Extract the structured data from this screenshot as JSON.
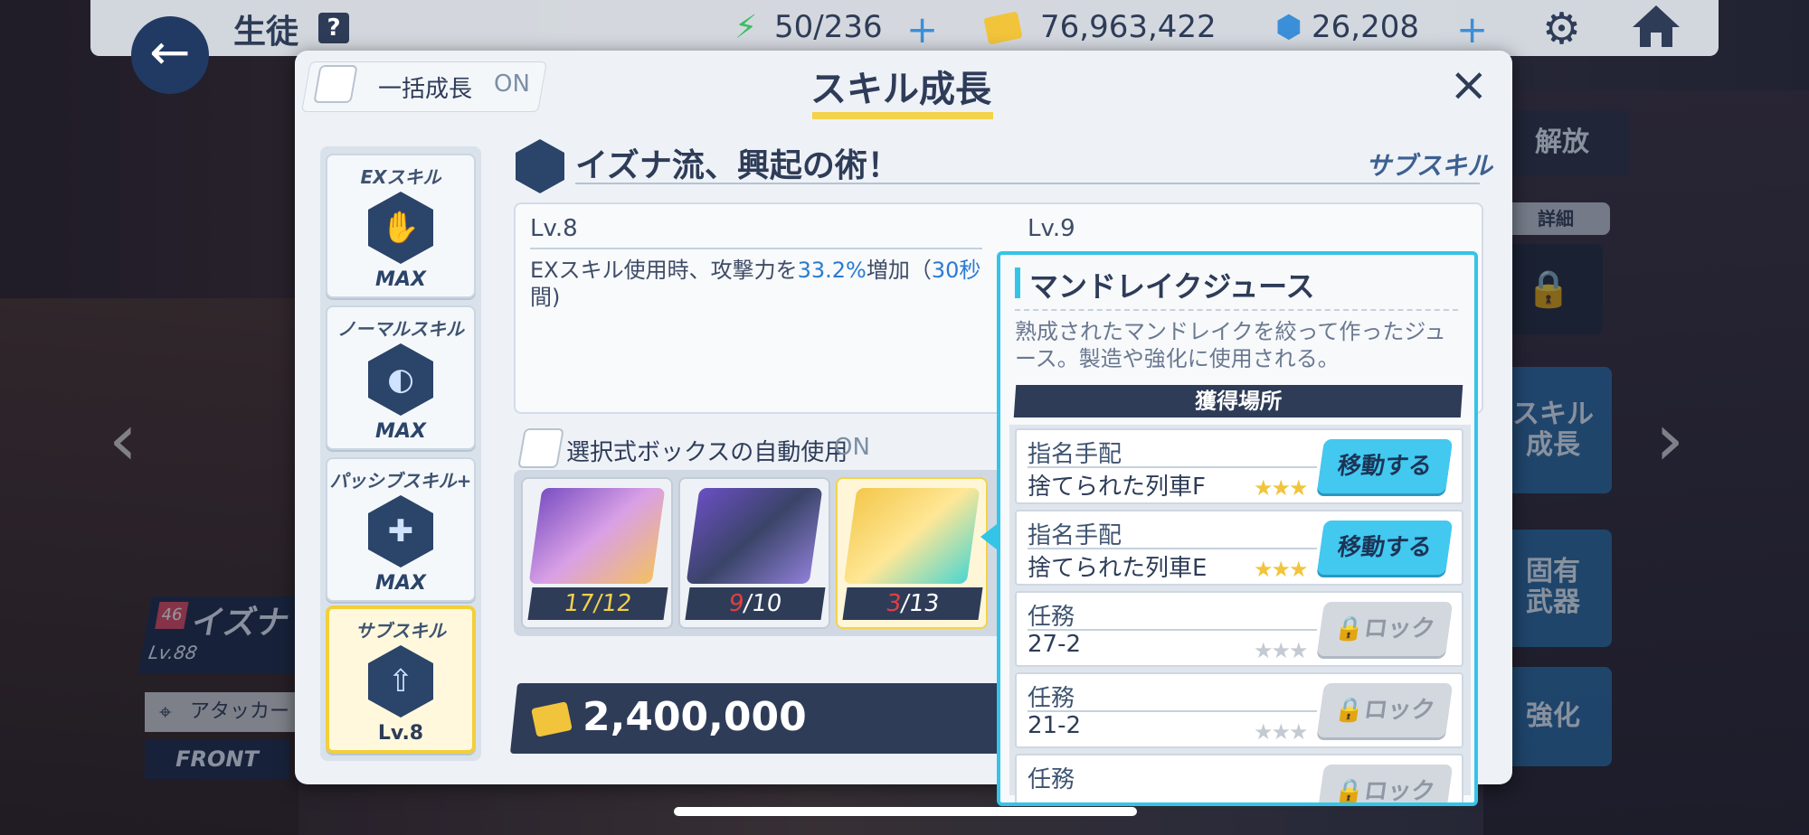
{
  "topbar": {
    "title": "生徒",
    "help": "?",
    "ap": "50/236",
    "credits": "76,963,422",
    "gems": "26,208",
    "plus": "+"
  },
  "right_panel": {
    "unlock": "解放",
    "detail": "詳細",
    "skill_growth": "スキル\n成長",
    "unique_weapon": "固有\n武器",
    "enhance": "強化"
  },
  "student": {
    "level_badge": "46",
    "name": "イズナ",
    "lv": "Lv.88",
    "role": "アタッカー",
    "position": "FRONT"
  },
  "modal": {
    "bulk_label": "一括成長",
    "bulk_on": "ON",
    "title": "スキル成長",
    "close": "×",
    "skills": [
      {
        "label": "EXスキル",
        "status": "MAX",
        "glyph": "✋"
      },
      {
        "label": "ノーマルスキル",
        "status": "MAX",
        "glyph": "◐"
      },
      {
        "label": "パッシブスキル+",
        "status": "MAX",
        "glyph": "✚"
      },
      {
        "label": "サブスキル",
        "status": "Lv.8",
        "glyph": "⇧"
      }
    ],
    "skill_name": "イズナ流、興起の術！",
    "skill_type": "サブスキル",
    "lv_current": "Lv.8",
    "lv_next": "Lv.9",
    "desc_pre": "EXスキル使用時、攻撃力を",
    "desc_val": "33.2%",
    "desc_mid": "増加（",
    "desc_time": "30秒",
    "desc_post": "間)",
    "auto_label": "選択式ボックスの自動使用",
    "auto_on": "ON",
    "items": [
      {
        "have": "17",
        "need": "/12"
      },
      {
        "have": "9",
        "need": "/10"
      },
      {
        "have": "3",
        "need": "/13"
      }
    ],
    "cost": "2,400,000"
  },
  "popup": {
    "title": "マンドレイクジュース",
    "desc": "熟成されたマンドレイクを絞って作ったジュース。製造や強化に使用される。",
    "header": "獲得場所",
    "sources": [
      {
        "cat": "指名手配",
        "name": "捨てられた列車F",
        "stars": "★★★",
        "btn": "移動する"
      },
      {
        "cat": "指名手配",
        "name": "捨てられた列車E",
        "stars": "★★★",
        "btn": "移動する"
      },
      {
        "cat": "任務",
        "name": "27-2",
        "stars": "★★★",
        "btn": "ロック"
      },
      {
        "cat": "任務",
        "name": "21-2",
        "stars": "★★★",
        "btn": "ロック"
      },
      {
        "cat": "任務",
        "name": "",
        "stars": "",
        "btn": "ロック"
      }
    ]
  }
}
